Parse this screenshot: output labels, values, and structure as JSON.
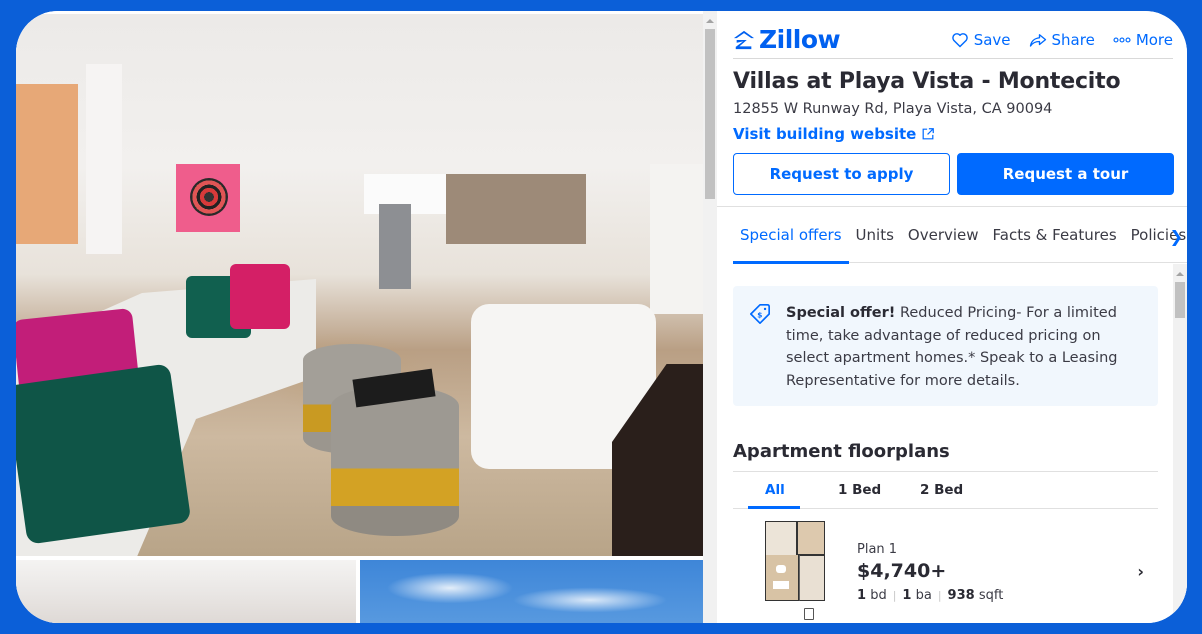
{
  "header": {
    "brand": "Zillow",
    "actions": [
      {
        "icon": "heart-icon",
        "label": "Save"
      },
      {
        "icon": "share-icon",
        "label": "Share"
      },
      {
        "icon": "more-dots-icon",
        "label": "More"
      }
    ]
  },
  "listing": {
    "title": "Villas at Playa Vista - Montecito",
    "address": "12855 W Runway Rd, Playa Vista, CA 90094",
    "website_link": "Visit building website",
    "buttons": {
      "apply": "Request to apply",
      "tour": "Request a tour"
    }
  },
  "tabs": [
    {
      "label": "Special offers",
      "active": true
    },
    {
      "label": "Units",
      "active": false
    },
    {
      "label": "Overview",
      "active": false
    },
    {
      "label": "Facts & Features",
      "active": false
    },
    {
      "label": "Policies",
      "active": false
    }
  ],
  "special_offer": {
    "icon": "price-tag-icon",
    "heading": "Special offer!",
    "text": " Reduced Pricing- For a limited time, take advantage of reduced pricing on select apartment homes.* Speak to a Leasing Representative for more details."
  },
  "floorplans": {
    "title": "Apartment floorplans",
    "filters": [
      {
        "label": "All",
        "active": true
      },
      {
        "label": "1 Bed",
        "active": false
      },
      {
        "label": "2 Bed",
        "active": false
      }
    ],
    "plans": [
      {
        "name": "Plan 1",
        "price": "$4,740+",
        "beds": "1",
        "beds_unit": "bd",
        "baths": "1",
        "baths_unit": "ba",
        "sqft": "938",
        "sqft_unit": "sqft"
      }
    ]
  },
  "gallery": {
    "photos": [
      "living-room-photo",
      "bedroom-photo",
      "sky-exterior-photo"
    ]
  },
  "colors": {
    "accent": "#006aff",
    "frame": "#0b5fd8",
    "offer_bg": "#f1f7fd"
  }
}
